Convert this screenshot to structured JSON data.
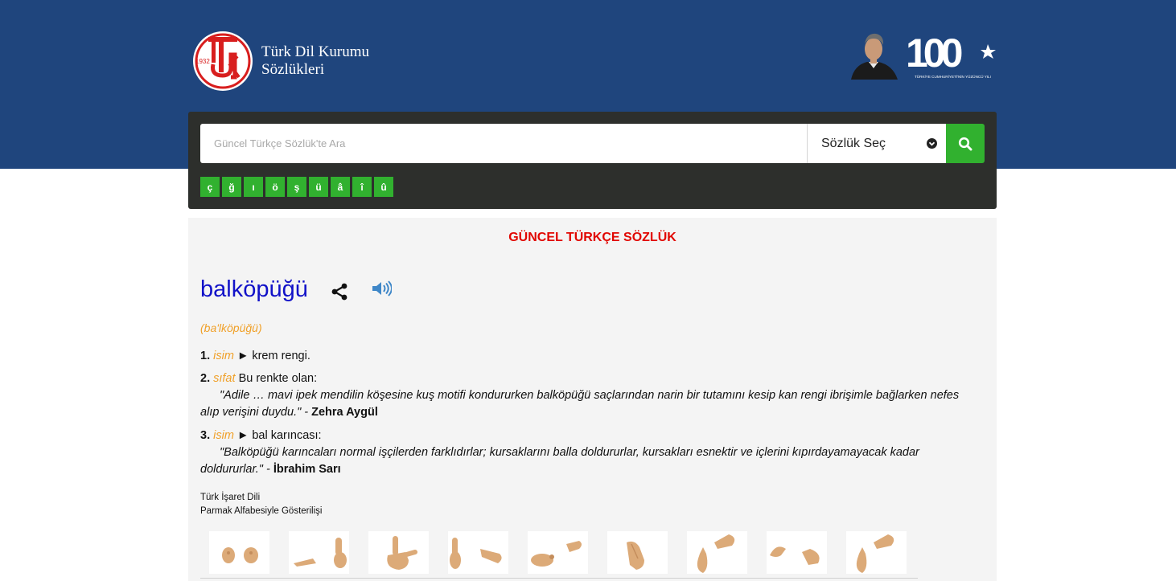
{
  "header": {
    "logo_year": "1932",
    "brand_line1": "Türk Dil Kurumu",
    "brand_line2": "Sözlükleri",
    "centennial_number": "100",
    "centennial_caption": "TÜRKİYE CUMHURİYETİ'NİN YÜZÜNCÜ YILI"
  },
  "search": {
    "placeholder": "Güncel Türkçe Sözlük'te Ara",
    "dictionary_select": "Sözlük Seç",
    "special_chars": [
      "ç",
      "ğ",
      "ı",
      "ö",
      "ş",
      "ü",
      "â",
      "î",
      "û"
    ]
  },
  "entry": {
    "dictionary_title": "GÜNCEL TÜRKÇE SÖZLÜK",
    "headword": "balköpüğü",
    "pronunciation": "(ba'lköpüğü)",
    "meanings": [
      {
        "num": "1.",
        "pos": "isim",
        "arrow": "►",
        "text": "krem rengi."
      },
      {
        "num": "2.",
        "pos": "sıfat",
        "text": "Bu renkte olan:",
        "quote": "\"Adile … mavi ipek mendilin köşesine kuş motifi kondururken balköpüğü saçlarından narin bir tutamını kesip kan rengi ibrişimle bağlarken nefes alıp verişini duydu.\"",
        "dash": " - ",
        "author": "Zehra Aygül"
      },
      {
        "num": "3.",
        "pos": "isim",
        "arrow": "►",
        "text": "bal karıncası:",
        "quote": "\"Balköpüğü karıncaları normal işçilerden farklıdırlar; kursaklarını balla doldururlar, kursakları esnektir ve içlerini kıpırdayamayacak kadar doldururlar.\"",
        "dash": " - ",
        "author": "İbrahim Sarı"
      }
    ],
    "sign_language_line1": "Türk İşaret Dili",
    "sign_language_line2": "Parmak Alfabesiyle Gösterilişi",
    "sign_letters": [
      "b",
      "a",
      "l",
      "k",
      "ö",
      "p",
      "ü",
      "ğ",
      "ü"
    ]
  },
  "colors": {
    "header_bg": "#1f457d",
    "panel_bg": "#2d2f2c",
    "accent_green": "#31b12f",
    "title_red": "#e10600",
    "headword_blue": "#1212c8",
    "pos_orange": "#f0a028"
  },
  "icons": [
    "tdk-logo-icon",
    "ataturk-portrait-icon",
    "centennial-100-icon",
    "chevron-down-icon",
    "search-icon",
    "share-icon",
    "speaker-icon",
    "hand-sign-icon"
  ]
}
